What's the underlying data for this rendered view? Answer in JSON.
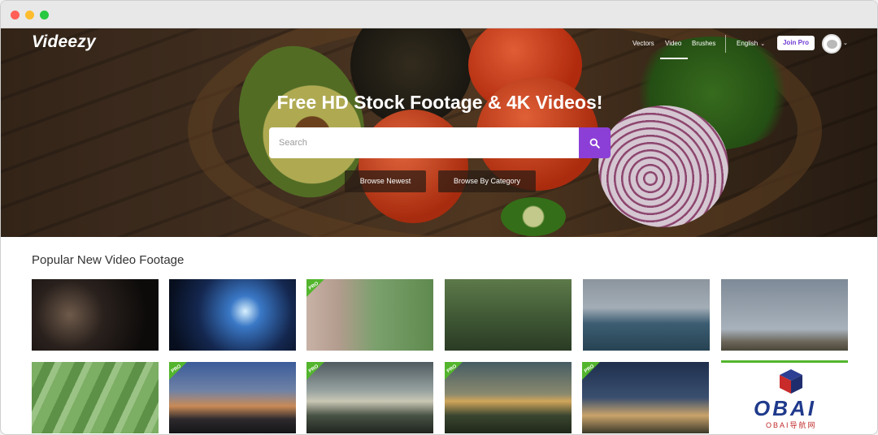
{
  "brand": {
    "logo": "Videezy"
  },
  "nav": {
    "items": [
      "Vectors",
      "Video",
      "Brushes"
    ],
    "active": "Video",
    "language": "English",
    "join_pro": "Join Pro"
  },
  "hero": {
    "title": "Free HD Stock Footage & 4K Videos!",
    "search_placeholder": "Search",
    "browse_newest": "Browse Newest",
    "browse_category": "Browse By Category"
  },
  "section": {
    "title": "Popular New Video Footage"
  },
  "thumbnails": [
    {
      "pro": false
    },
    {
      "pro": false
    },
    {
      "pro": true
    },
    {
      "pro": false
    },
    {
      "pro": false
    },
    {
      "pro": false
    },
    {
      "pro": false
    },
    {
      "pro": true
    },
    {
      "pro": true
    },
    {
      "pro": true
    },
    {
      "pro": true
    }
  ],
  "pro_badge": "PRO",
  "watermark": {
    "text": "OBAI",
    "sub": "OBAI导航网"
  },
  "colors": {
    "accent": "#8c3fd6",
    "pro": "#53b52d"
  }
}
